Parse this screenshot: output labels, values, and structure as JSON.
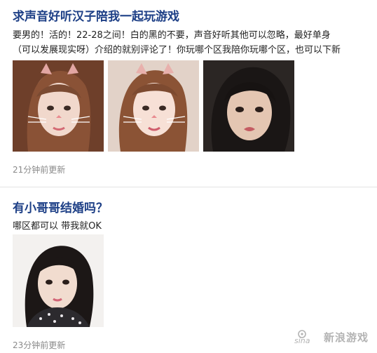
{
  "colors": {
    "title": "#1d3f86",
    "meta": "#8a8a8a",
    "divider": "#e3e3e3"
  },
  "posts": [
    {
      "title": "求声音好听汉子陪我一起玩游戏",
      "body_lines": [
        "要男的！活的！22-28之间！白的黑的不要，声音好听其他可以忽略，最好单身",
        "（可以发展现实呀）介绍的就别评论了！你玩哪个区我陪你玩哪个区，也可以下新"
      ],
      "photos": [
        {
          "desc": "photo-cat-filter-1"
        },
        {
          "desc": "photo-cat-filter-2"
        },
        {
          "desc": "photo-selfie-pout"
        }
      ],
      "time": "21分钟前更新"
    },
    {
      "title": "有小哥哥结婚吗？",
      "body_lines": [
        "哪区都可以 带我就OK"
      ],
      "photos": [
        {
          "desc": "photo-selfie-dark-hair"
        }
      ],
      "time": "23分钟前更新"
    }
  ],
  "watermark": {
    "logo_text": "sina",
    "text": "新浪游戏"
  }
}
